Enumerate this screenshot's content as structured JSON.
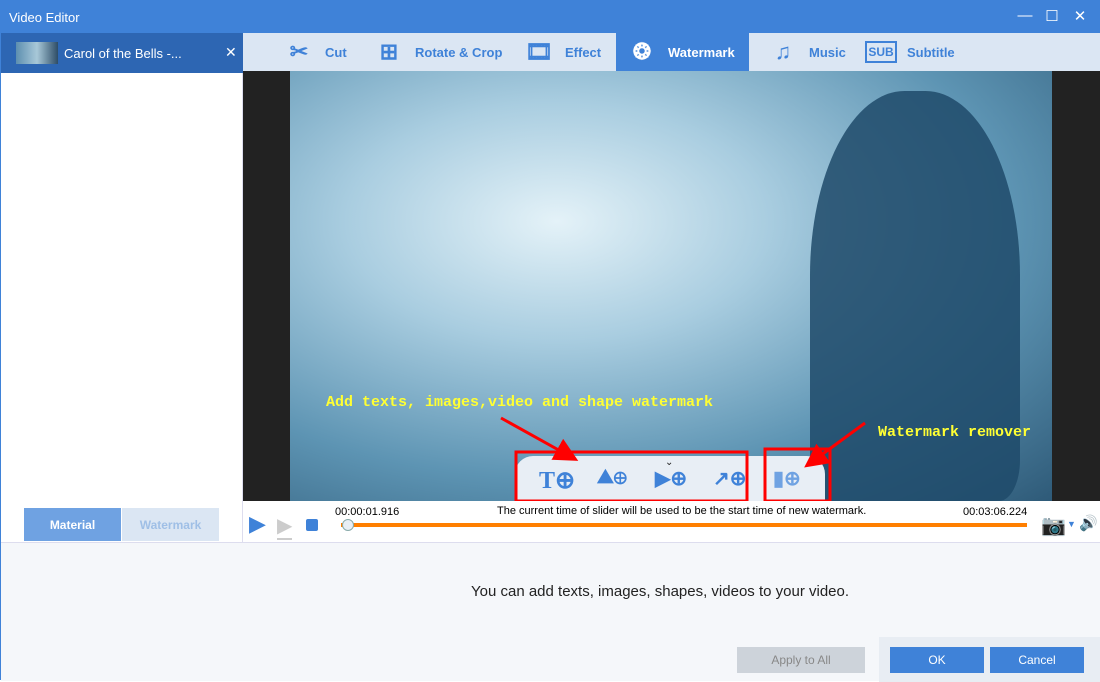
{
  "window": {
    "title": "Video Editor"
  },
  "file_tab": {
    "name": "Carol of the Bells -..."
  },
  "toolbar": {
    "tabs": [
      {
        "label": "Cut",
        "icon": "scissors-icon"
      },
      {
        "label": "Rotate & Crop",
        "icon": "crop-icon"
      },
      {
        "label": "Effect",
        "icon": "effect-icon"
      },
      {
        "label": "Watermark",
        "icon": "watermark-icon",
        "active": true
      },
      {
        "label": "Music",
        "icon": "music-icon"
      },
      {
        "label": "Subtitle",
        "icon": "subtitle-icon"
      }
    ]
  },
  "annotations": {
    "add": "Add texts, images,video and shape watermark",
    "remover": "Watermark remover"
  },
  "watermark_tools": [
    "add-text",
    "add-image",
    "add-video",
    "add-shape",
    "watermark-remover"
  ],
  "player": {
    "current_time": "00:00:01.916",
    "total_time": "00:03:06.224",
    "hint": "The current time of slider will be used to be the start time of new watermark.",
    "progress_percent": 1.0,
    "accent": "#ff7f00"
  },
  "side_tabs": {
    "material": "Material",
    "watermark": "Watermark"
  },
  "bottom": {
    "message": "You can add texts, images, shapes, videos to your video.",
    "apply_all": "Apply to All",
    "ok": "OK",
    "cancel": "Cancel"
  },
  "colors": {
    "brand": "#3f82d8",
    "annotation": "#ffff33",
    "highlight": "#ff0000"
  }
}
